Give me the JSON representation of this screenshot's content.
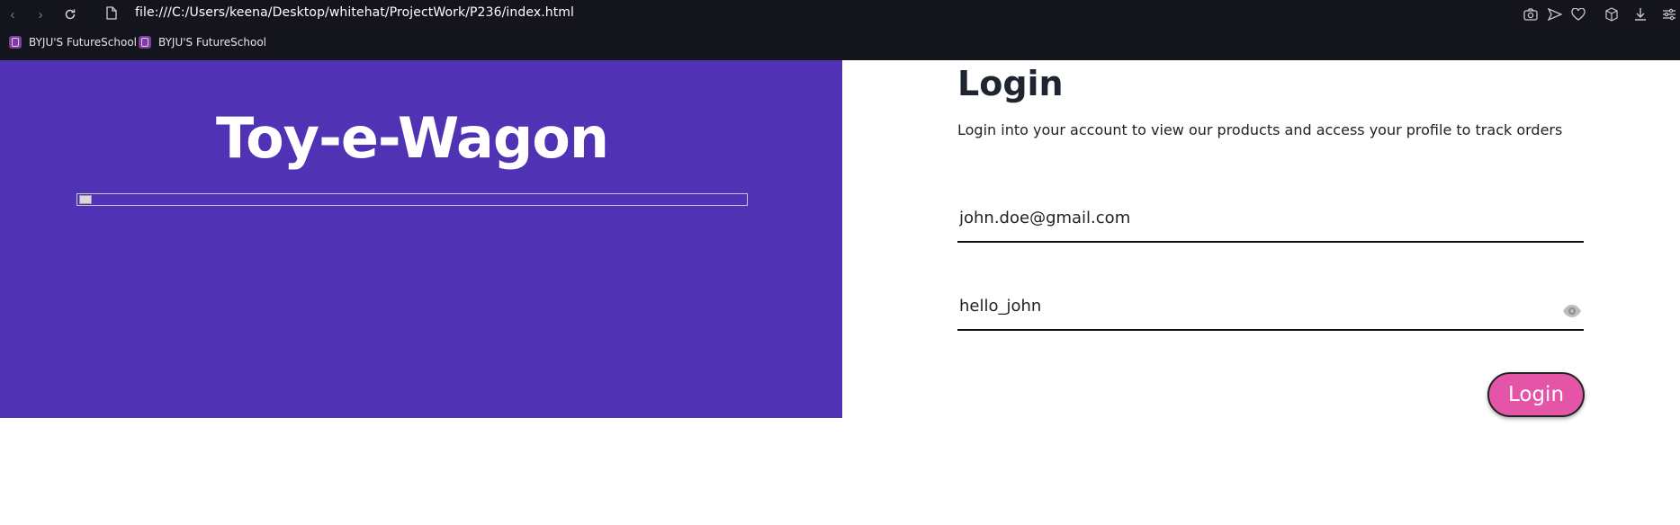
{
  "browser": {
    "url": "file:///C:/Users/keena/Desktop/whitehat/ProjectWork/P236/index.html",
    "bookmarks": [
      {
        "label": "BYJU'S FutureSchool"
      },
      {
        "label": "BYJU'S FutureSchool"
      }
    ]
  },
  "hero": {
    "brand_title": "Toy-e-Wagon"
  },
  "login": {
    "title": "Login",
    "subtitle": "Login into your account to view our products and access your profile to track orders",
    "email_value": "john.doe@gmail.com",
    "password_value": "hello_john",
    "button_label": "Login"
  },
  "colors": {
    "hero_bg": "#5033b5",
    "button_bg": "#e455a8",
    "chrome_bg": "#14141c"
  }
}
